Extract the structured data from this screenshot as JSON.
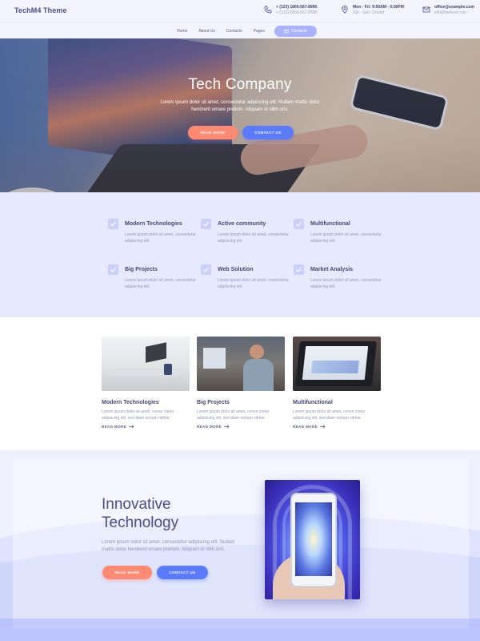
{
  "header": {
    "logo": "TechM4 Theme",
    "phone": {
      "icon": "phone-icon",
      "line1": "+ (123) 1800-567-8990",
      "line2": "+ (123) 1800-567-8990"
    },
    "hours": {
      "icon": "location-pin-icon",
      "line1": "Mon - Fri: 9:00AM - 5:00PM",
      "line2": "Sat - Sun: Closed"
    },
    "email": {
      "icon": "mail-icon",
      "line1": "office@example.com",
      "line2": "info@mekcel.com"
    }
  },
  "nav": {
    "items": [
      "Home",
      "About Us",
      "Contacts",
      "Pages"
    ],
    "cta_label": "Contacts",
    "cta_icon": "mail-icon"
  },
  "hero": {
    "title": "Tech Company",
    "text": "Lorem ipsum dolor sit amet, consectetur adipiscing elit. Nullam mattis dolor hendrerit ornare pretium. Aliquam id nibh orci.",
    "btn_primary": "READ MORE",
    "btn_secondary": "CONTACT US"
  },
  "features": [
    {
      "title": "Modern Technologies",
      "text": "Lorem ipsum dolor sit amet, consectetur adipiscing elit."
    },
    {
      "title": "Active community",
      "text": "Lorem ipsum dolor sit amet, consectetur adipiscing elit."
    },
    {
      "title": "Multifunctional",
      "text": "Lorem ipsum dolor sit amet, consectetur adipiscing elit."
    },
    {
      "title": "Big Projects",
      "text": "Lorem ipsum dolor sit amet, consectetur adipiscing elit."
    },
    {
      "title": "Web Solution",
      "text": "Lorem ipsum dolor sit amet, consectetur adipiscing elit."
    },
    {
      "title": "Market Analysis",
      "text": "Lorem ipsum dolor sit amet, consectetur adipiscing elit."
    }
  ],
  "cards": [
    {
      "title": "Modern Technologies",
      "text": "Lorem ipsum dolor sit amet, conse ctetur adipiscing elit, sed diam nonum nibhie.",
      "more": "READ MORE"
    },
    {
      "title": "Big Projects",
      "text": "Lorem ipsum dolor sit amet, conse ctetur adipiscing elit, sed diam nonum nibhie.",
      "more": "READ MORE"
    },
    {
      "title": "Multifunctional",
      "text": "Lorem ipsum dolor sit amet, conse ctetur adipiscing elit, sed diam nonum nibhie.",
      "more": "READ MORE"
    }
  ],
  "innovation": {
    "title_line1": "Innovative",
    "title_line2": "Technology",
    "text": "Lorem ipsum dolor sit amet, consectetur adipiscing elit. Nullam mattis dolor hendrerit ornare pretium. Aliquam id nibh orci.",
    "btn_primary": "READ MORE",
    "btn_secondary": "CONTACT US"
  },
  "colors": {
    "accent_orange": "#ff8a73",
    "accent_blue": "#5b7bff",
    "heading": "#444877",
    "feature_bg": "#e7eafe"
  }
}
